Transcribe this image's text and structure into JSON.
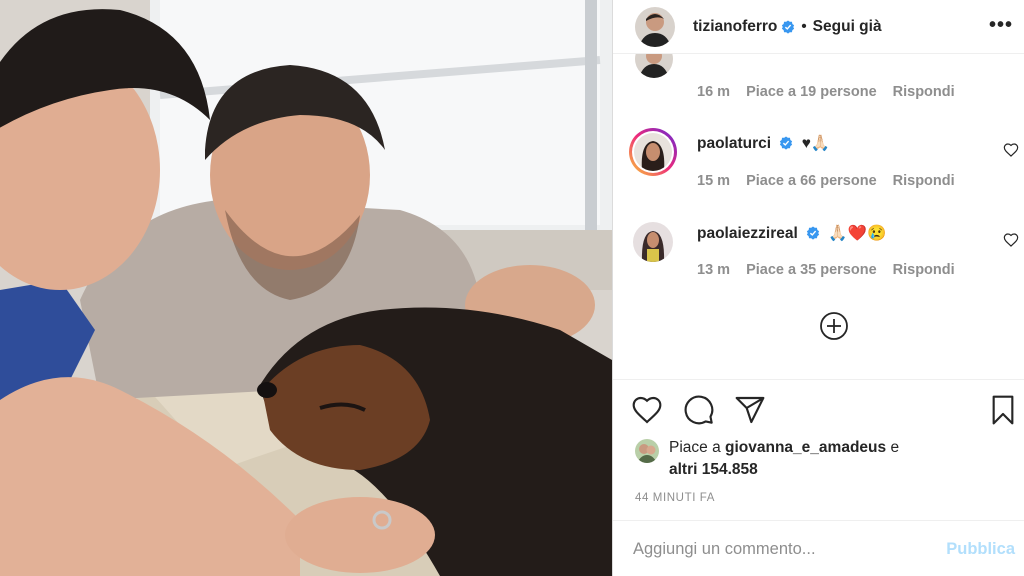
{
  "post": {
    "username": "tizianoferro",
    "follow_status": "Segui già",
    "more_label": "•••"
  },
  "comments_top": {
    "time": "16 m",
    "likes": "Piace a 19 persone",
    "reply": "Rispondi"
  },
  "comments": [
    {
      "username": "paolaturci",
      "text": "♥🙏🏻",
      "time": "15 m",
      "likes": "Piace a 66 persone",
      "reply": "Rispondi"
    },
    {
      "username": "paolaiezzireal",
      "text": "🙏🏻❤️😢",
      "time": "13 m",
      "likes": "Piace a 35 persone",
      "reply": "Rispondi"
    }
  ],
  "likes_summary": {
    "prefix": "Piace a",
    "user": "giovanna_e_amadeus",
    "suffix": "e",
    "others": "altri 154.858"
  },
  "timestamp": "44 MINUTI FA",
  "add_comment": {
    "placeholder": "Aggiungi un commento...",
    "publish": "Pubblica"
  },
  "colors": {
    "accent_verified": "#3897f0",
    "publish_disabled": "#b2dffc",
    "muted": "#8e8e8e"
  },
  "icons": [
    "verified-badge-icon",
    "heart-icon",
    "comment-icon",
    "share-icon",
    "bookmark-icon",
    "add-circle-icon",
    "more-options-icon"
  ]
}
